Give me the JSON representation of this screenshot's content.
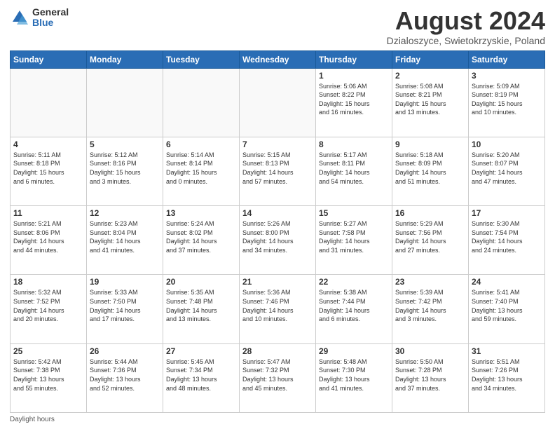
{
  "logo": {
    "general": "General",
    "blue": "Blue"
  },
  "header": {
    "month": "August 2024",
    "location": "Dzialoszyce, Swietokrzyskie, Poland"
  },
  "days_of_week": [
    "Sunday",
    "Monday",
    "Tuesday",
    "Wednesday",
    "Thursday",
    "Friday",
    "Saturday"
  ],
  "weeks": [
    [
      {
        "day": "",
        "info": ""
      },
      {
        "day": "",
        "info": ""
      },
      {
        "day": "",
        "info": ""
      },
      {
        "day": "",
        "info": ""
      },
      {
        "day": "1",
        "info": "Sunrise: 5:06 AM\nSunset: 8:22 PM\nDaylight: 15 hours\nand 16 minutes."
      },
      {
        "day": "2",
        "info": "Sunrise: 5:08 AM\nSunset: 8:21 PM\nDaylight: 15 hours\nand 13 minutes."
      },
      {
        "day": "3",
        "info": "Sunrise: 5:09 AM\nSunset: 8:19 PM\nDaylight: 15 hours\nand 10 minutes."
      }
    ],
    [
      {
        "day": "4",
        "info": "Sunrise: 5:11 AM\nSunset: 8:18 PM\nDaylight: 15 hours\nand 6 minutes."
      },
      {
        "day": "5",
        "info": "Sunrise: 5:12 AM\nSunset: 8:16 PM\nDaylight: 15 hours\nand 3 minutes."
      },
      {
        "day": "6",
        "info": "Sunrise: 5:14 AM\nSunset: 8:14 PM\nDaylight: 15 hours\nand 0 minutes."
      },
      {
        "day": "7",
        "info": "Sunrise: 5:15 AM\nSunset: 8:13 PM\nDaylight: 14 hours\nand 57 minutes."
      },
      {
        "day": "8",
        "info": "Sunrise: 5:17 AM\nSunset: 8:11 PM\nDaylight: 14 hours\nand 54 minutes."
      },
      {
        "day": "9",
        "info": "Sunrise: 5:18 AM\nSunset: 8:09 PM\nDaylight: 14 hours\nand 51 minutes."
      },
      {
        "day": "10",
        "info": "Sunrise: 5:20 AM\nSunset: 8:07 PM\nDaylight: 14 hours\nand 47 minutes."
      }
    ],
    [
      {
        "day": "11",
        "info": "Sunrise: 5:21 AM\nSunset: 8:06 PM\nDaylight: 14 hours\nand 44 minutes."
      },
      {
        "day": "12",
        "info": "Sunrise: 5:23 AM\nSunset: 8:04 PM\nDaylight: 14 hours\nand 41 minutes."
      },
      {
        "day": "13",
        "info": "Sunrise: 5:24 AM\nSunset: 8:02 PM\nDaylight: 14 hours\nand 37 minutes."
      },
      {
        "day": "14",
        "info": "Sunrise: 5:26 AM\nSunset: 8:00 PM\nDaylight: 14 hours\nand 34 minutes."
      },
      {
        "day": "15",
        "info": "Sunrise: 5:27 AM\nSunset: 7:58 PM\nDaylight: 14 hours\nand 31 minutes."
      },
      {
        "day": "16",
        "info": "Sunrise: 5:29 AM\nSunset: 7:56 PM\nDaylight: 14 hours\nand 27 minutes."
      },
      {
        "day": "17",
        "info": "Sunrise: 5:30 AM\nSunset: 7:54 PM\nDaylight: 14 hours\nand 24 minutes."
      }
    ],
    [
      {
        "day": "18",
        "info": "Sunrise: 5:32 AM\nSunset: 7:52 PM\nDaylight: 14 hours\nand 20 minutes."
      },
      {
        "day": "19",
        "info": "Sunrise: 5:33 AM\nSunset: 7:50 PM\nDaylight: 14 hours\nand 17 minutes."
      },
      {
        "day": "20",
        "info": "Sunrise: 5:35 AM\nSunset: 7:48 PM\nDaylight: 14 hours\nand 13 minutes."
      },
      {
        "day": "21",
        "info": "Sunrise: 5:36 AM\nSunset: 7:46 PM\nDaylight: 14 hours\nand 10 minutes."
      },
      {
        "day": "22",
        "info": "Sunrise: 5:38 AM\nSunset: 7:44 PM\nDaylight: 14 hours\nand 6 minutes."
      },
      {
        "day": "23",
        "info": "Sunrise: 5:39 AM\nSunset: 7:42 PM\nDaylight: 14 hours\nand 3 minutes."
      },
      {
        "day": "24",
        "info": "Sunrise: 5:41 AM\nSunset: 7:40 PM\nDaylight: 13 hours\nand 59 minutes."
      }
    ],
    [
      {
        "day": "25",
        "info": "Sunrise: 5:42 AM\nSunset: 7:38 PM\nDaylight: 13 hours\nand 55 minutes."
      },
      {
        "day": "26",
        "info": "Sunrise: 5:44 AM\nSunset: 7:36 PM\nDaylight: 13 hours\nand 52 minutes."
      },
      {
        "day": "27",
        "info": "Sunrise: 5:45 AM\nSunset: 7:34 PM\nDaylight: 13 hours\nand 48 minutes."
      },
      {
        "day": "28",
        "info": "Sunrise: 5:47 AM\nSunset: 7:32 PM\nDaylight: 13 hours\nand 45 minutes."
      },
      {
        "day": "29",
        "info": "Sunrise: 5:48 AM\nSunset: 7:30 PM\nDaylight: 13 hours\nand 41 minutes."
      },
      {
        "day": "30",
        "info": "Sunrise: 5:50 AM\nSunset: 7:28 PM\nDaylight: 13 hours\nand 37 minutes."
      },
      {
        "day": "31",
        "info": "Sunrise: 5:51 AM\nSunset: 7:26 PM\nDaylight: 13 hours\nand 34 minutes."
      }
    ]
  ],
  "footer": {
    "note": "Daylight hours"
  }
}
